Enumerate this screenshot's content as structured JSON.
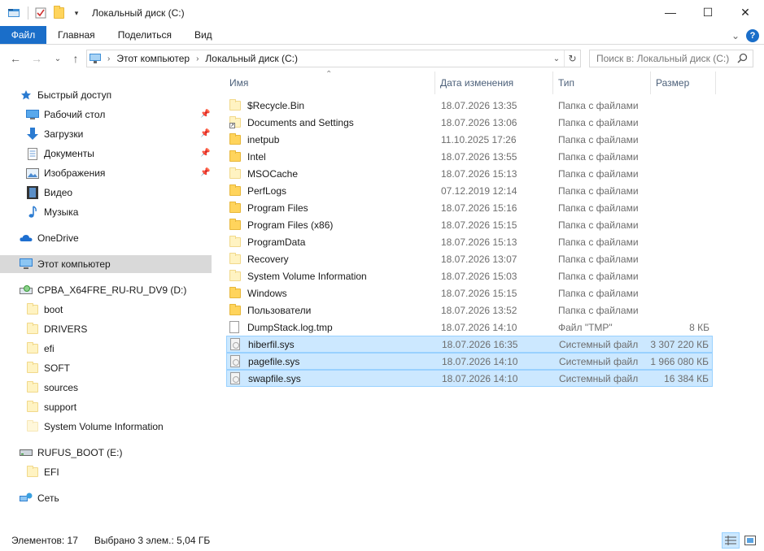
{
  "window": {
    "title": "Локальный диск (C:)",
    "minimize": "—",
    "maximize": "☐",
    "close": "✕"
  },
  "ribbon": {
    "tabs": [
      "Файл",
      "Главная",
      "Поделиться",
      "Вид"
    ],
    "collapse": "⌄",
    "help": "?"
  },
  "nav": {
    "back": "←",
    "forward": "→",
    "recent": "⌄",
    "up": "↑",
    "breadcrumb": [
      "Этот компьютер",
      "Локальный диск (C:)"
    ],
    "search_placeholder": "Поиск в: Локальный диск (C:)"
  },
  "sidebar": {
    "items": [
      {
        "label": "Быстрый доступ",
        "icon": "star-icon"
      },
      {
        "label": "Рабочий стол",
        "icon": "desktop-icon",
        "pinned": true
      },
      {
        "label": "Загрузки",
        "icon": "download-icon",
        "pinned": true
      },
      {
        "label": "Документы",
        "icon": "documents-icon",
        "pinned": true
      },
      {
        "label": "Изображения",
        "icon": "pictures-icon",
        "pinned": true
      },
      {
        "label": "Видео",
        "icon": "video-icon"
      },
      {
        "label": "Музыка",
        "icon": "music-icon"
      },
      {
        "label": "OneDrive",
        "icon": "cloud-icon"
      },
      {
        "label": "Этот компьютер",
        "icon": "computer-icon",
        "selected": true
      },
      {
        "label": "CPBA_X64FRE_RU-RU_DV9 (D:)",
        "icon": "dvd-drive-icon"
      },
      {
        "label": "boot",
        "icon": "folder-icon"
      },
      {
        "label": "DRIVERS",
        "icon": "folder-icon"
      },
      {
        "label": "efi",
        "icon": "folder-icon"
      },
      {
        "label": "SOFT",
        "icon": "folder-icon"
      },
      {
        "label": "sources",
        "icon": "folder-icon"
      },
      {
        "label": "support",
        "icon": "folder-icon"
      },
      {
        "label": "System Volume Information",
        "icon": "folder-icon"
      },
      {
        "label": "RUFUS_BOOT (E:)",
        "icon": "usb-drive-icon"
      },
      {
        "label": "EFI",
        "icon": "folder-icon"
      },
      {
        "label": "Сеть",
        "icon": "network-icon"
      }
    ]
  },
  "columns": {
    "name": "Имя",
    "date": "Дата изменения",
    "type": "Тип",
    "size": "Размер"
  },
  "files": [
    {
      "name": "$Recycle.Bin",
      "date": "18.07.2026 13:35",
      "type": "Папка с файлами",
      "size": "",
      "kind": "folder-light"
    },
    {
      "name": "Documents and Settings",
      "date": "18.07.2026 13:06",
      "type": "Папка с файлами",
      "size": "",
      "kind": "folder-link"
    },
    {
      "name": "inetpub",
      "date": "11.10.2025 17:26",
      "type": "Папка с файлами",
      "size": "",
      "kind": "folder"
    },
    {
      "name": "Intel",
      "date": "18.07.2026 13:55",
      "type": "Папка с файлами",
      "size": "",
      "kind": "folder"
    },
    {
      "name": "MSOCache",
      "date": "18.07.2026 15:13",
      "type": "Папка с файлами",
      "size": "",
      "kind": "folder-light"
    },
    {
      "name": "PerfLogs",
      "date": "07.12.2019 12:14",
      "type": "Папка с файлами",
      "size": "",
      "kind": "folder"
    },
    {
      "name": "Program Files",
      "date": "18.07.2026 15:16",
      "type": "Папка с файлами",
      "size": "",
      "kind": "folder"
    },
    {
      "name": "Program Files (x86)",
      "date": "18.07.2026 15:15",
      "type": "Папка с файлами",
      "size": "",
      "kind": "folder"
    },
    {
      "name": "ProgramData",
      "date": "18.07.2026 15:13",
      "type": "Папка с файлами",
      "size": "",
      "kind": "folder-light"
    },
    {
      "name": "Recovery",
      "date": "18.07.2026 13:07",
      "type": "Папка с файлами",
      "size": "",
      "kind": "folder-light"
    },
    {
      "name": "System Volume Information",
      "date": "18.07.2026 15:03",
      "type": "Папка с файлами",
      "size": "",
      "kind": "folder-light"
    },
    {
      "name": "Windows",
      "date": "18.07.2026 15:15",
      "type": "Папка с файлами",
      "size": "",
      "kind": "folder"
    },
    {
      "name": "Пользователи",
      "date": "18.07.2026 13:52",
      "type": "Папка с файлами",
      "size": "",
      "kind": "folder"
    },
    {
      "name": "DumpStack.log.tmp",
      "date": "18.07.2026 14:10",
      "type": "Файл \"TMP\"",
      "size": "8 КБ",
      "kind": "file"
    },
    {
      "name": "hiberfil.sys",
      "date": "18.07.2026 16:35",
      "type": "Системный файл",
      "size": "3 307 220 КБ",
      "kind": "sysfile",
      "selected": true
    },
    {
      "name": "pagefile.sys",
      "date": "18.07.2026 14:10",
      "type": "Системный файл",
      "size": "1 966 080 КБ",
      "kind": "sysfile",
      "selected": true
    },
    {
      "name": "swapfile.sys",
      "date": "18.07.2026 14:10",
      "type": "Системный файл",
      "size": "16 384 КБ",
      "kind": "sysfile",
      "selected": true
    }
  ],
  "status": {
    "items_count": "Элементов: 17",
    "selected": "Выбрано 3 элем.: 5,04 ГБ"
  },
  "colors": {
    "accent": "#1a6ec9",
    "selection_bg": "#cce8ff",
    "selection_border": "#99d1ff",
    "header_text": "#4c607a"
  }
}
